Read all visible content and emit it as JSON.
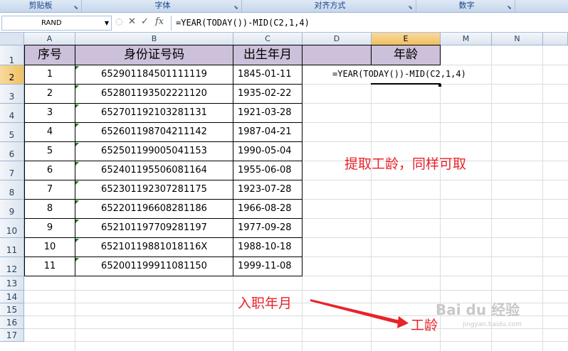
{
  "ribbon": {
    "groups": [
      {
        "label": "剪贴板"
      },
      {
        "label": "字体"
      },
      {
        "label": "对齐方式"
      },
      {
        "label": "数字"
      }
    ]
  },
  "formula_bar": {
    "name_box": "RAND",
    "fx_label": "fx",
    "cancel_icon": "✕",
    "enter_icon": "✓",
    "formula": "=YEAR(TODAY())-MID(C2,1,4)"
  },
  "columns": [
    "A",
    "B",
    "C",
    "D",
    "E",
    "M",
    "N"
  ],
  "row_numbers": [
    "1",
    "2",
    "3",
    "4",
    "5",
    "6",
    "7",
    "8",
    "9",
    "10",
    "11",
    "12",
    "13",
    "14",
    "15",
    "16",
    "17"
  ],
  "table": {
    "headers": {
      "seq": "序号",
      "id": "身份证号码",
      "birth": "出生年月",
      "age": "年龄"
    },
    "rows": [
      {
        "seq": "1",
        "id": "652901184501111119",
        "birth": "1845-01-11"
      },
      {
        "seq": "2",
        "id": "652801193502221120",
        "birth": "1935-02-22"
      },
      {
        "seq": "3",
        "id": "652701192103281131",
        "birth": "1921-03-28"
      },
      {
        "seq": "4",
        "id": "652601198704211142",
        "birth": "1987-04-21"
      },
      {
        "seq": "5",
        "id": "652501199005041153",
        "birth": "1990-05-04"
      },
      {
        "seq": "6",
        "id": "652401195506081164",
        "birth": "1955-06-08"
      },
      {
        "seq": "7",
        "id": "652301192307281175",
        "birth": "1923-07-28"
      },
      {
        "seq": "8",
        "id": "652201196608281186",
        "birth": "1966-08-28"
      },
      {
        "seq": "9",
        "id": "652101197709281197",
        "birth": "1977-09-28"
      },
      {
        "seq": "10",
        "id": "65210119881018116X",
        "birth": "1988-10-18"
      },
      {
        "seq": "11",
        "id": "652001199911081150",
        "birth": "1999-11-08"
      }
    ]
  },
  "editing_cell": {
    "formula": "=YEAR(TODAY())-MID(C2,1,4)"
  },
  "annotations": {
    "note1": "提取工龄，同样可取",
    "note2": "入职年月",
    "note3": "工龄"
  },
  "watermark": {
    "text": "Bai du 经验",
    "sub": "jingyan.baidu.com"
  },
  "colors": {
    "header_fill": "#ccc0da",
    "annotation": "#e8232a",
    "selected_header": "#f1c15f"
  }
}
